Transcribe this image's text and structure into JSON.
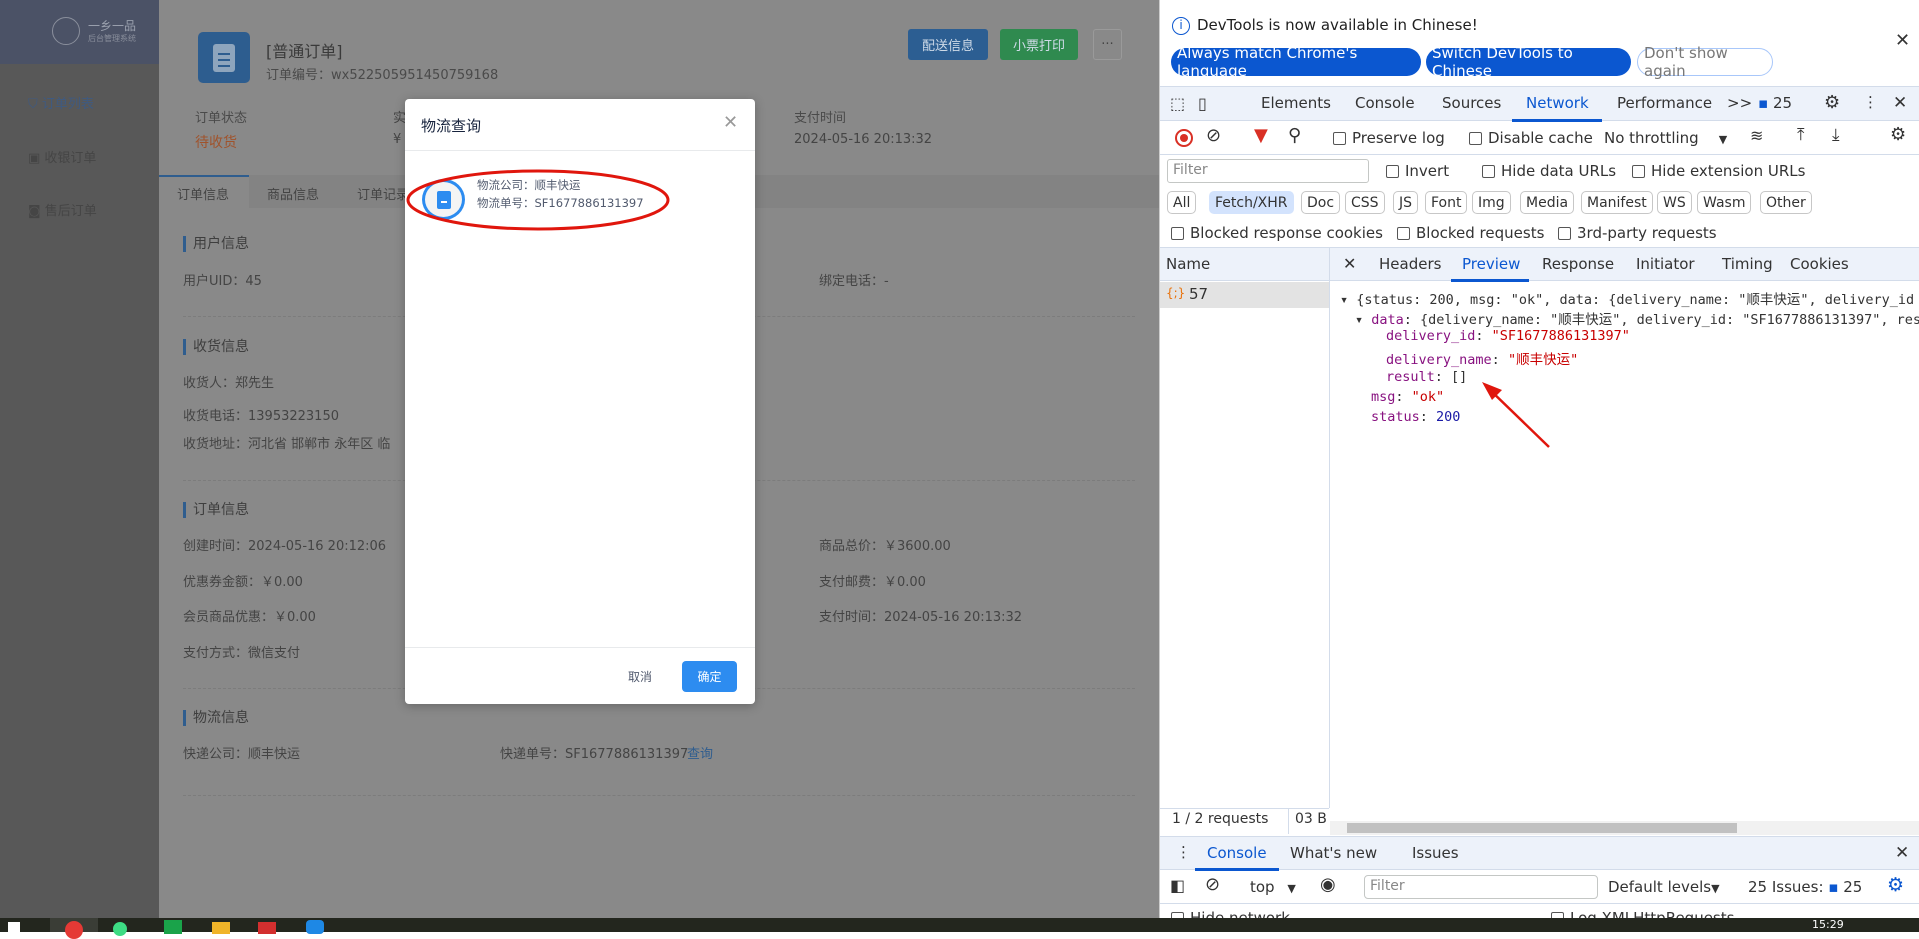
{
  "sidebar": {
    "logo_title": "一乡一品",
    "logo_sub": "后台管理系统",
    "items": [
      {
        "label": "订单列表",
        "icon": "cart-icon"
      },
      {
        "label": "收银订单",
        "icon": "cashier-icon"
      },
      {
        "label": "售后订单",
        "icon": "after-sale-icon"
      }
    ]
  },
  "order": {
    "type": "[普通订单]",
    "number_label": "订单编号：",
    "number": "wx522505951450759168",
    "buttons": {
      "delivery": "配送信息",
      "print": "小票打印",
      "more": "···"
    },
    "summary": [
      {
        "label": "订单状态",
        "value": "待收货"
      },
      {
        "label": "实",
        "value": "¥"
      },
      {
        "label": "支付时间",
        "value": "2024-05-16 20:13:32"
      }
    ],
    "tabs": [
      "订单信息",
      "商品信息",
      "订单记录"
    ],
    "user": {
      "title": "用户信息",
      "uid": "用户UID：45",
      "phone": "绑定电话：-"
    },
    "shipping": {
      "title": "收货信息",
      "name": "收货人：郑先生",
      "phone": "收货电话：13953223150",
      "address": "收货地址：河北省 邯郸市 永年区 临"
    },
    "info": {
      "title": "订单信息",
      "created": "创建时间：2024-05-16 20:12:06",
      "total": "商品总价：￥3600.00",
      "coupon": "优惠券金额：￥0.00",
      "postage": "支付邮费：￥0.00",
      "member": "会员商品优惠：￥0.00",
      "paytime": "支付时间：2024-05-16 20:13:32",
      "paymethod": "支付方式：微信支付"
    },
    "logistics": {
      "title": "物流信息",
      "company": "快递公司：顺丰快运",
      "number": "快递单号：SF1677886131397",
      "query": "查询"
    }
  },
  "modal": {
    "title": "物流查询",
    "company": "物流公司：顺丰快运",
    "number": "物流单号：SF1677886131397",
    "cancel": "取消",
    "ok": "确定",
    "accent": "#2d8cf0"
  },
  "devtools": {
    "banner": {
      "text": "DevTools is now available in Chinese!",
      "btn1": "Always match Chrome's language",
      "btn2": "Switch DevTools to Chinese",
      "btn3": "Don't show again"
    },
    "tabs": [
      "Elements",
      "Console",
      "Sources",
      "Network",
      "Performance"
    ],
    "active_tab": "Network",
    "more": ">>",
    "issues_count": "25",
    "toolbar": {
      "preserve_log": "Preserve log",
      "disable_cache": "Disable cache",
      "throttling": "No throttling"
    },
    "filter": {
      "placeholder": "Filter",
      "invert": "Invert",
      "hide_data": "Hide data URLs",
      "hide_ext": "Hide extension URLs"
    },
    "types": [
      "All",
      "Fetch/XHR",
      "Doc",
      "CSS",
      "JS",
      "Font",
      "Img",
      "Media",
      "Manifest",
      "WS",
      "Wasm",
      "Other"
    ],
    "active_type": "Fetch/XHR",
    "blocked": {
      "cookies": "Blocked response cookies",
      "requests": "Blocked requests",
      "third": "3rd-party requests"
    },
    "name_header": "Name",
    "request": "57",
    "detail_tabs": [
      "Headers",
      "Preview",
      "Response",
      "Initiator",
      "Timing",
      "Cookies"
    ],
    "active_detail": "Preview",
    "preview": {
      "line1": "{status: 200, msg: \"ok\", data: {delivery_name: \"顺丰快运\", delivery_id",
      "line2_key": "data",
      "line2": ": {delivery_name: \"顺丰快运\", delivery_id: \"SF1677886131397\", res",
      "delivery_id_key": "delivery_id",
      "delivery_id": "\"SF1677886131397\"",
      "delivery_name_key": "delivery_name",
      "delivery_name": "\"顺丰快运\"",
      "result_key": "result",
      "result": "[]",
      "msg_key": "msg",
      "msg": "\"ok\"",
      "status_key": "status",
      "status": "200"
    },
    "status_bar": {
      "requests": "1 / 2 requests",
      "size": "03 B"
    },
    "drawer": {
      "tabs": [
        "Console",
        "What's new",
        "Issues"
      ],
      "context": "top",
      "filter_placeholder": "Filter",
      "levels": "Default levels",
      "issues": "25 Issues:",
      "issues_count": "25",
      "row_left": "Hide network",
      "row_right": "Log XMLHttpRequests"
    }
  },
  "taskbar": {
    "time": "15:29"
  }
}
